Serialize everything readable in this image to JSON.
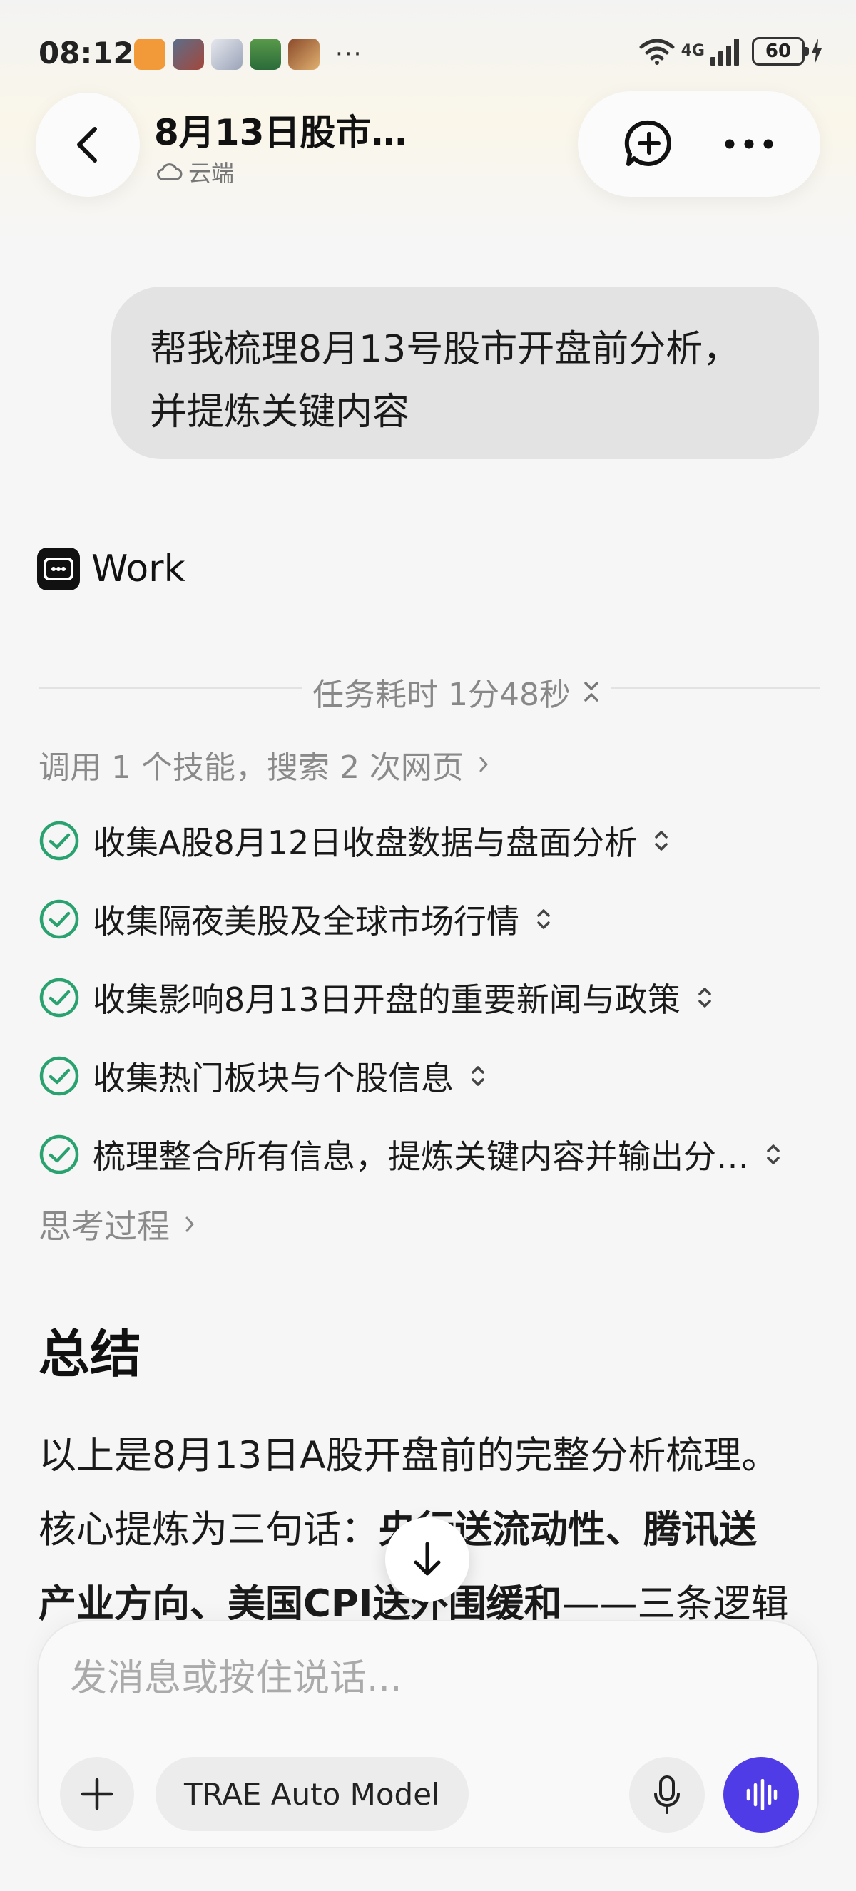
{
  "status_bar": {
    "time": "08:12",
    "more": "···",
    "network": "4G",
    "battery": "60"
  },
  "header": {
    "title": "8月13日股市…",
    "subtitle": "云端"
  },
  "user_message": {
    "line1": "帮我梳理8月13号股市开盘前分析，",
    "line2": "并提炼关键内容"
  },
  "work": {
    "label": "Work",
    "duration": "任务耗时 1分48秒",
    "skills_summary": "调用 1 个技能，搜索 2 次网页",
    "tasks": [
      {
        "text": "收集A股8月12日收盘数据与盘面分析",
        "status": "done"
      },
      {
        "text": "收集隔夜美股及全球市场行情",
        "status": "done"
      },
      {
        "text": "收集影响8月13日开盘的重要新闻与政策",
        "status": "done"
      },
      {
        "text": "收集热门板块与个股信息",
        "status": "done"
      },
      {
        "text": "梳理整合所有信息，提炼关键内容并输出分…",
        "status": "done"
      }
    ],
    "thinking": "思考过程"
  },
  "summary": {
    "title": "总结",
    "line1": "以上是8月13日A股开盘前的完整分析梳理。",
    "line2_plain": "核心提炼为三句话：",
    "line2_bold": "央行送流动性、腾讯送",
    "line3_bold": "产业方向、美国CPI送外围缓和",
    "line3_plain": "——三条逻辑"
  },
  "composer": {
    "placeholder": "发消息或按住说话...",
    "model": "TRAE Auto Model"
  },
  "colors": {
    "accent": "#4f3ce6",
    "check": "#2aa26f",
    "bubble": "#e3e3e3"
  },
  "icons": [
    "back-arrow-icon",
    "cloud-icon",
    "new-chat-icon",
    "more-icon",
    "work-icon",
    "collapse-icon",
    "chevron-right-icon",
    "check-circle-icon",
    "expand-toggle-icon",
    "arrow-down-icon",
    "plus-icon",
    "mic-icon",
    "voice-wave-icon"
  ]
}
